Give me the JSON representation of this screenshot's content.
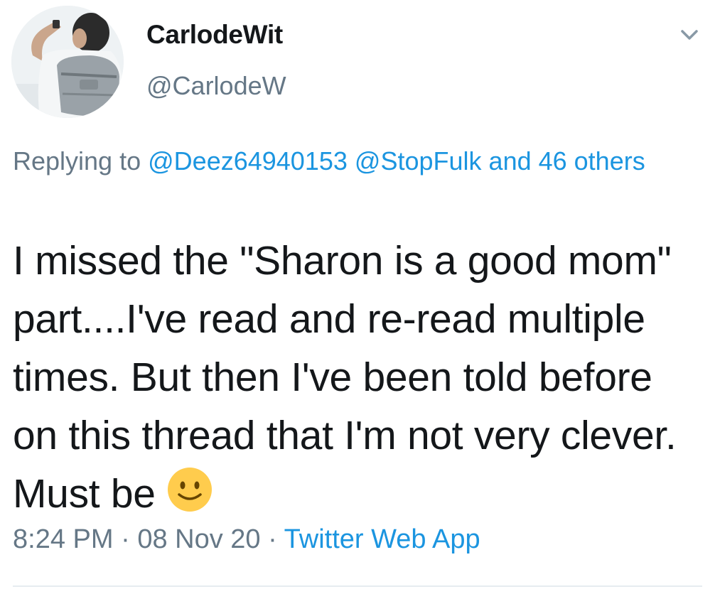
{
  "user": {
    "display_name": "CarlodeWit",
    "handle": "@CarlodeW",
    "avatar_icon": "profile-photo-man-with-backpack"
  },
  "reply": {
    "prefix": "Replying to",
    "mention_1": "@Deez64940153",
    "mention_2": "@StopFulk",
    "others": "and 46 others"
  },
  "tweet": {
    "text": "I missed the \"Sharon is a good mom\" part....I've read and re-read multiple times. But then I've been told before on this thread that I'm not very clever. Must be",
    "emoji": "slightly-smiling-face-icon"
  },
  "meta": {
    "time": "8:24 PM",
    "separator": "·",
    "date": "08 Nov 20",
    "source": "Twitter Web App"
  },
  "colors": {
    "link": "#1b95e0",
    "secondary_text": "#657786",
    "primary_text": "#14171a",
    "emoji_yellow": "#ffcc4d"
  }
}
